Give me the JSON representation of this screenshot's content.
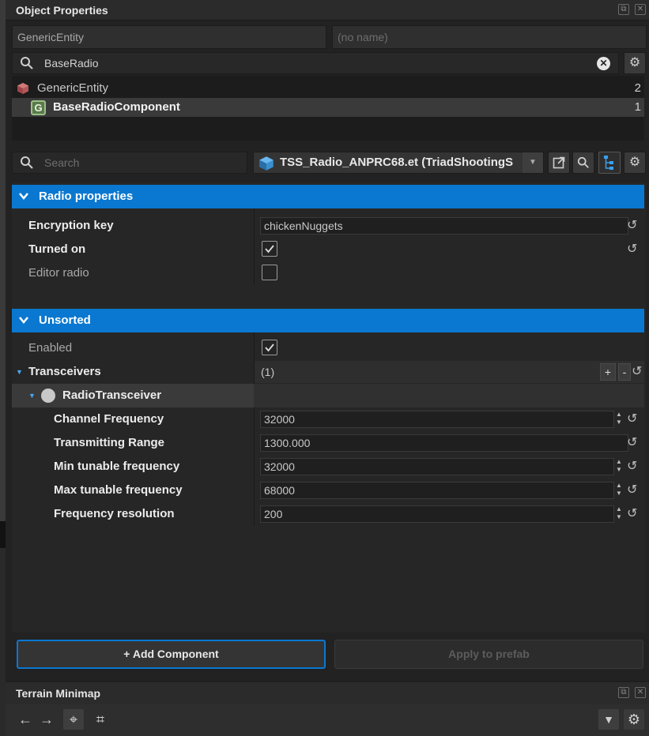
{
  "window": {
    "title": "Object Properties"
  },
  "entity": {
    "type_field": "GenericEntity",
    "name_placeholder": "(no name)"
  },
  "component_search": {
    "value": "BaseRadio"
  },
  "tree": {
    "items": [
      {
        "label": "GenericEntity",
        "count": "2"
      },
      {
        "label": "BaseRadioComponent",
        "count": "1"
      }
    ]
  },
  "toolbar": {
    "search_placeholder": "Search",
    "prefab_label": "TSS_Radio_ANPRC68.et (TriadShootingS"
  },
  "categories": {
    "radio": "Radio properties",
    "unsorted": "Unsorted"
  },
  "props": {
    "encryption_key": {
      "label": "Encryption key",
      "value": "chickenNuggets"
    },
    "turned_on": {
      "label": "Turned on",
      "checked": true
    },
    "editor_radio": {
      "label": "Editor radio",
      "checked": false
    },
    "enabled": {
      "label": "Enabled",
      "checked": true
    },
    "transceivers": {
      "label": "Transceivers",
      "count": "(1)",
      "add": "+",
      "remove": "-"
    },
    "radio_transceiver": {
      "label": "RadioTransceiver"
    },
    "channel_frequency": {
      "label": "Channel Frequency",
      "value": "32000"
    },
    "transmitting_range": {
      "label": "Transmitting Range",
      "value": "1300.000"
    },
    "min_tunable": {
      "label": "Min tunable frequency",
      "value": "32000"
    },
    "max_tunable": {
      "label": "Max tunable frequency",
      "value": "68000"
    },
    "frequency_resolution": {
      "label": "Frequency resolution",
      "value": "200"
    }
  },
  "buttons": {
    "add_component": "+ Add Component",
    "apply_prefab": "Apply to prefab"
  },
  "minimap": {
    "title": "Terrain Minimap"
  },
  "colors": {
    "accent": "#0a78d0",
    "background": "#222222"
  }
}
